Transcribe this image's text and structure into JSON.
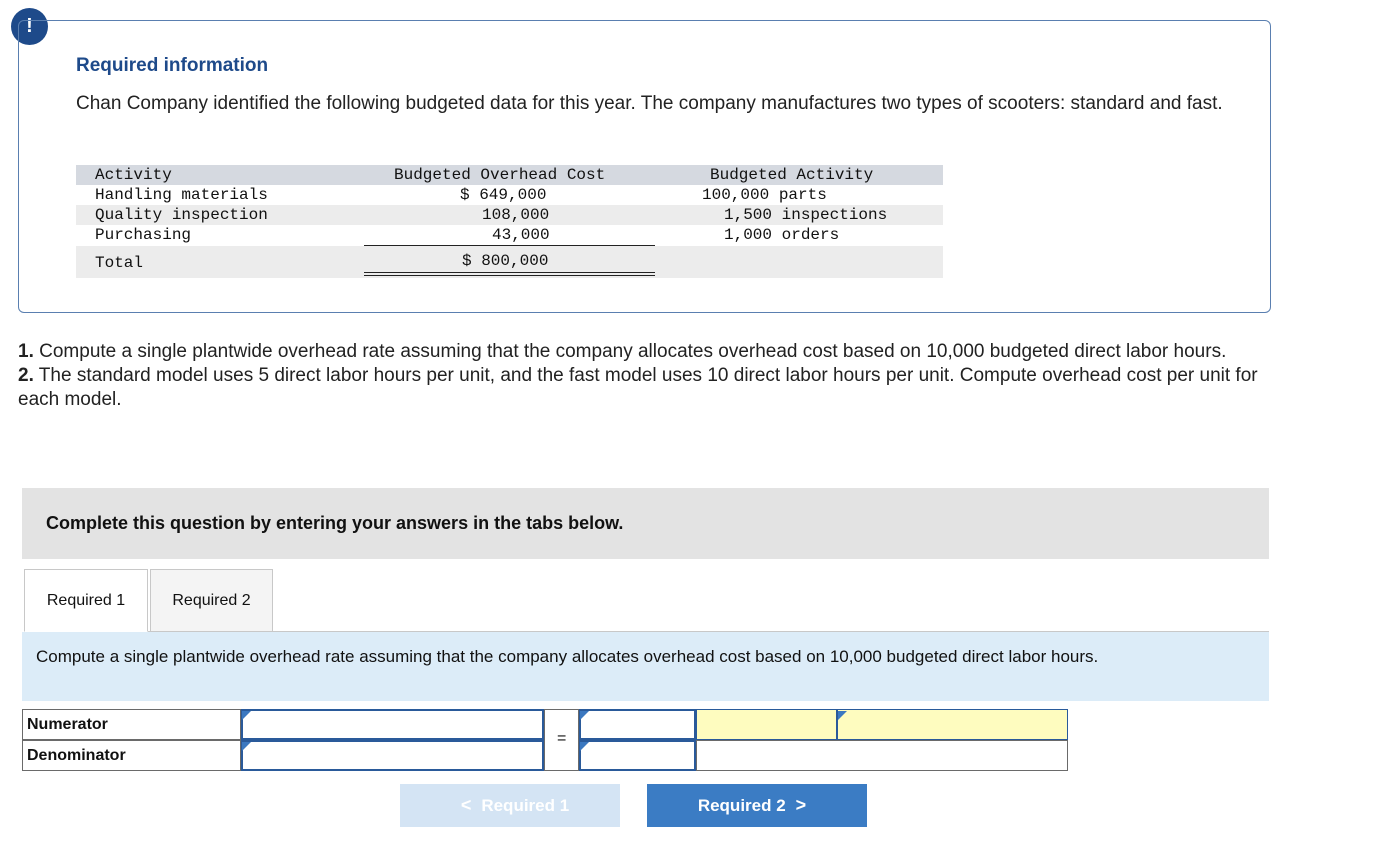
{
  "alert": {
    "symbol": "!"
  },
  "info": {
    "title": "Required information",
    "text": "Chan Company identified the following budgeted data for this year. The company manufactures two types of scooters: standard and fast."
  },
  "table": {
    "headers": [
      "Activity",
      "Budgeted Overhead Cost",
      "Budgeted Activity"
    ],
    "rows": [
      {
        "activity": "Handling materials",
        "cost": "$ 649,000",
        "driver": "100,000 parts"
      },
      {
        "activity": "Quality inspection",
        "cost": "108,000",
        "driver": "1,500 inspections"
      },
      {
        "activity": "Purchasing",
        "cost": "43,000",
        "driver": "1,000 orders"
      }
    ],
    "total_label": "Total",
    "total_cost": "$ 800,000"
  },
  "questions": [
    {
      "num": "1.",
      "text": " Compute a single plantwide overhead rate assuming that the company allocates overhead cost based on 10,000 budgeted direct labor hours."
    },
    {
      "num": "2.",
      "text": " The standard model uses 5 direct labor hours per unit, and the fast model uses 10 direct labor hours per unit. Compute overhead cost per unit for each model."
    }
  ],
  "banner": "Complete this question by entering your answers in the tabs below.",
  "tabs": [
    "Required 1",
    "Required 2"
  ],
  "instruction": "Compute a single plantwide overhead rate assuming that the company allocates overhead cost based on 10,000 budgeted direct labor hours.",
  "answer": {
    "numerator_label": "Numerator",
    "denominator_label": "Denominator",
    "equals": "=",
    "numerator_value": "",
    "denominator_value": "",
    "result_value": "",
    "result_unit": ""
  },
  "nav": {
    "prev_label": "Required 1",
    "next_label": "Required 2",
    "prev_chevron": "<",
    "next_chevron": ">"
  }
}
